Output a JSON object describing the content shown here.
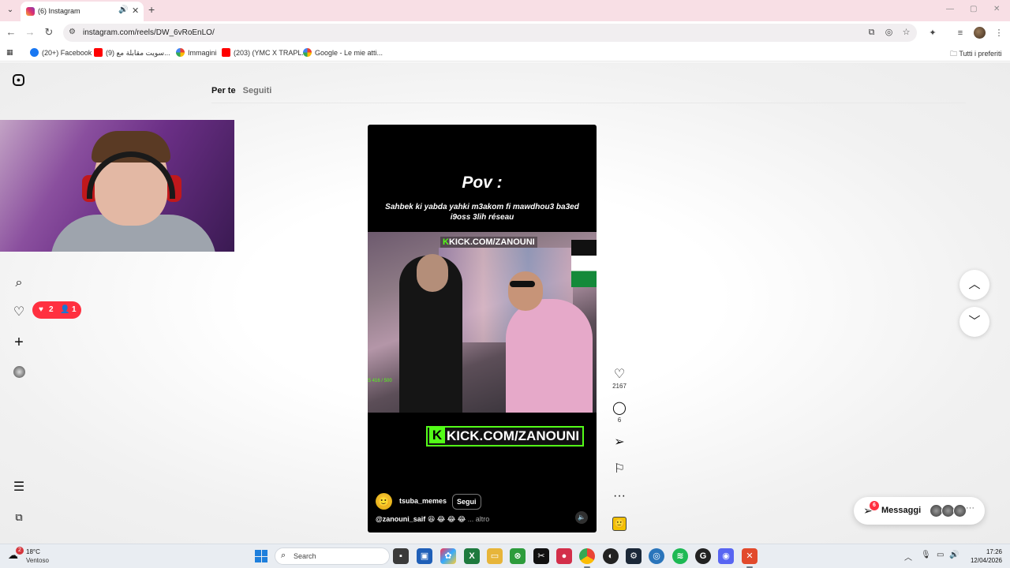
{
  "browser": {
    "tab_title": "(6) Instagram",
    "url": "instagram.com/reels/DW_6vRoEnLO/",
    "bookmarks": [
      "(20+) Facebook",
      "(9) سويت مقابلة مع...",
      "Immagini",
      "(203) (YMC X TRAPL...",
      "Google - Le mie atti..."
    ],
    "all_bookmarks": "Tutti i preferiti"
  },
  "instagram": {
    "feed_tabs": [
      "Per te",
      "Seguiti"
    ],
    "notif_likes": "2",
    "notif_followers": "1",
    "reel": {
      "title": "Pov :",
      "caption": "Sahbek ki yabda yahki m3akom fi mawdhou3 ba3ed i9oss 3lih réseau",
      "kick_top": "KICK.COM/ZANOUNI",
      "kick_bottom": "KICK.COM/ZANOUNI",
      "sub_count": "S 416 / 500",
      "username": "tsuba_memes",
      "follow_label": "Segui",
      "description_user": "@zanouni_saif",
      "description_emojis": "😆 😂 😂 😂",
      "description_more": "... altro"
    },
    "actions": {
      "likes": "2167",
      "comments": "6"
    },
    "messages": {
      "label": "Messaggi",
      "badge": "6"
    }
  },
  "taskbar": {
    "temperature": "18°C",
    "condition": "Ventoso",
    "weather_badge": "2",
    "search_placeholder": "Search",
    "time": "17:26",
    "date": "12/04/2026"
  }
}
